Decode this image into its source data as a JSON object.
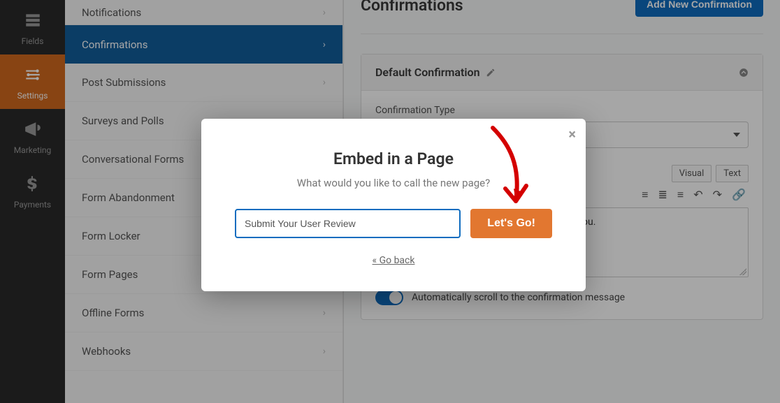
{
  "rail": {
    "items": [
      {
        "label": "Fields"
      },
      {
        "label": "Settings"
      },
      {
        "label": "Marketing"
      },
      {
        "label": "Payments"
      }
    ]
  },
  "sidebar": {
    "items": [
      {
        "label": "Notifications"
      },
      {
        "label": "Confirmations"
      },
      {
        "label": "Post Submissions"
      },
      {
        "label": "Surveys and Polls"
      },
      {
        "label": "Conversational Forms"
      },
      {
        "label": "Form Abandonment"
      },
      {
        "label": "Form Locker"
      },
      {
        "label": "Form Pages"
      },
      {
        "label": "Offline Forms"
      },
      {
        "label": "Webhooks"
      }
    ]
  },
  "main": {
    "title": "Confirmations",
    "add_button": "Add New Confirmation",
    "panel_title": "Default Confirmation",
    "type_label": "Confirmation Type",
    "visual_tab": "Visual",
    "text_tab": "Text",
    "editor_snippet": "iate you.",
    "toggle_label": "Automatically scroll to the confirmation message"
  },
  "modal": {
    "title": "Embed in a Page",
    "subtitle": "What would you like to call the new page?",
    "input_value": "Submit Your User Review",
    "go_label": "Let's Go!",
    "back_label": "« Go back",
    "close": "×"
  }
}
